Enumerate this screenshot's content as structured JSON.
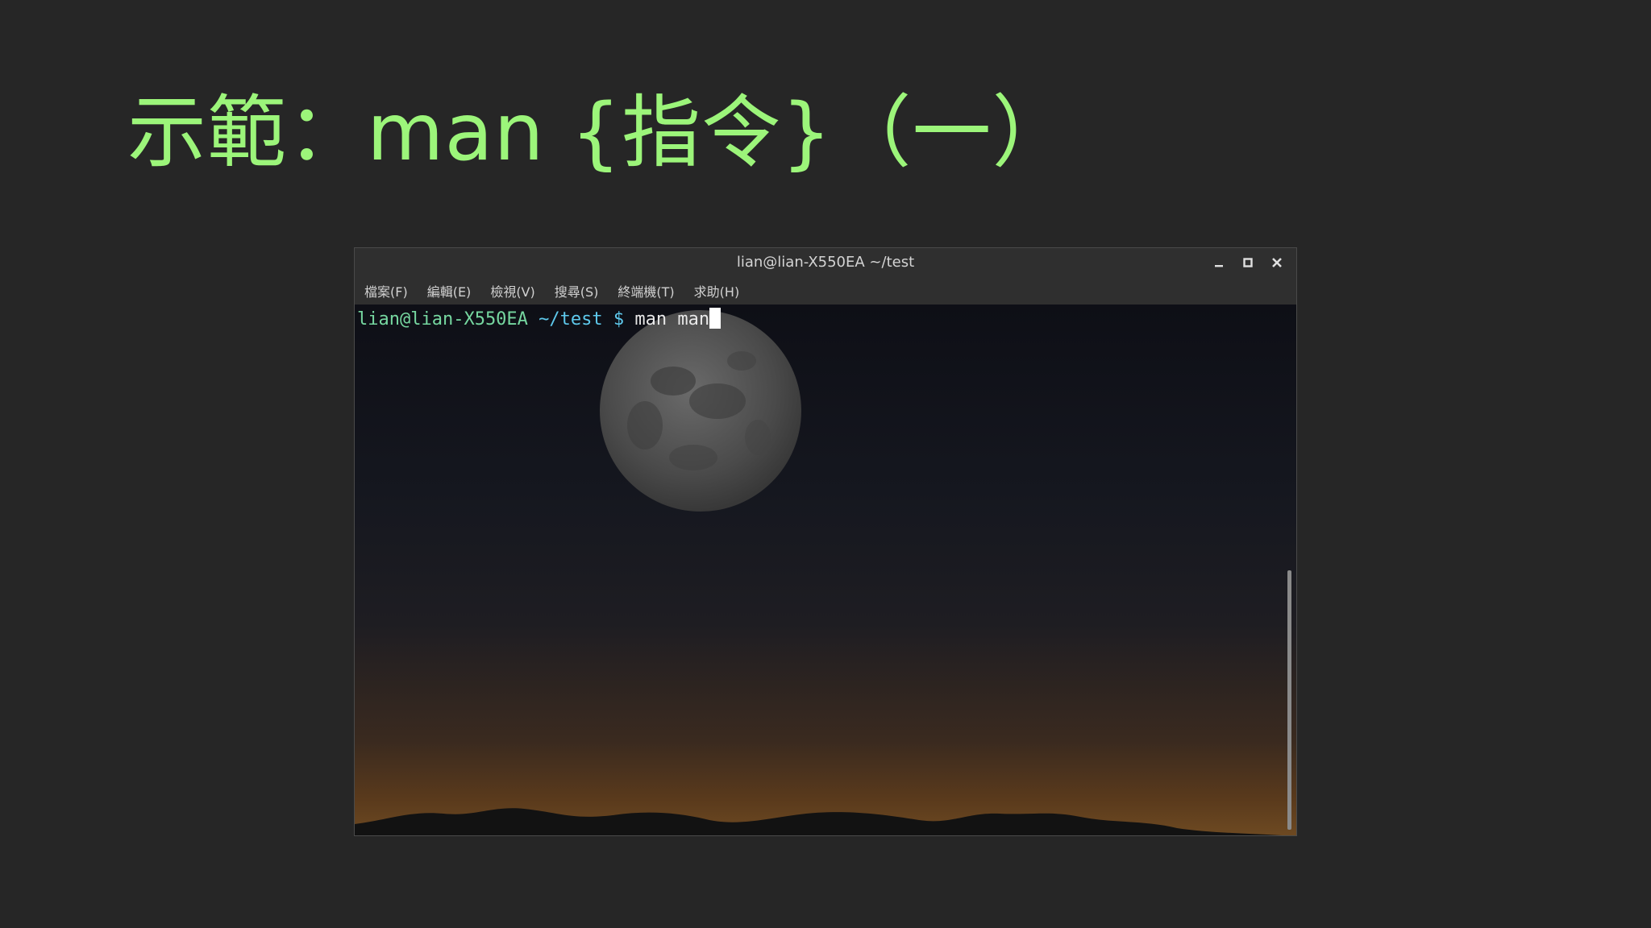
{
  "slide": {
    "title": "示範：man {指令}（一）"
  },
  "terminal": {
    "window_title": "lian@lian-X550EA ~/test",
    "controls": {
      "minimize_icon": "minimize-icon",
      "maximize_icon": "maximize-icon",
      "close_icon": "close-icon"
    },
    "menu": [
      {
        "label": "檔案(F)"
      },
      {
        "label": "編輯(E)"
      },
      {
        "label": "檢視(V)"
      },
      {
        "label": "搜尋(S)"
      },
      {
        "label": "終端機(T)"
      },
      {
        "label": "求助(H)"
      }
    ],
    "prompt": {
      "user_host": "lian@lian-X550EA",
      "path": "~/test",
      "symbol": "$",
      "command": "man man"
    },
    "background": "moon-over-night-sky"
  },
  "colors": {
    "slide_background": "#262626",
    "title": "#9cf57a",
    "prompt_user": "#76d7a0",
    "prompt_path": "#5ec9ec"
  }
}
